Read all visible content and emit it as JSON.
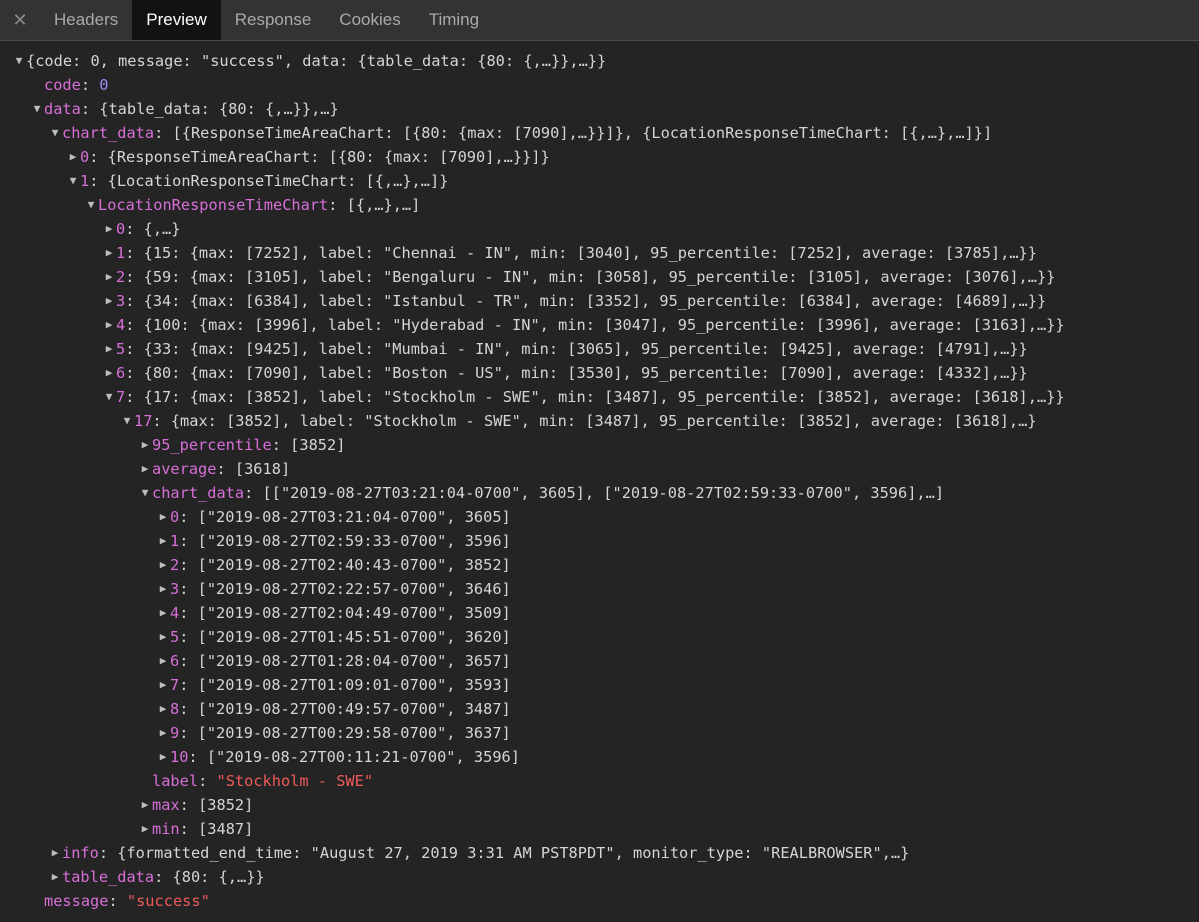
{
  "tabs": {
    "close_glyph": "✕",
    "items": [
      {
        "label": "Headers",
        "active": false
      },
      {
        "label": "Preview",
        "active": true
      },
      {
        "label": "Response",
        "active": false
      },
      {
        "label": "Cookies",
        "active": false
      },
      {
        "label": "Timing",
        "active": false
      }
    ]
  },
  "tree": [
    {
      "indent": 0,
      "toggle": "expanded",
      "text": "{code: 0, message: \"success\", data: {table_data: {80: {,…}},…}}"
    },
    {
      "indent": 1,
      "toggle": "none",
      "key": "code",
      "sep": ": ",
      "value": "0",
      "vtype": "num"
    },
    {
      "indent": 1,
      "toggle": "expanded",
      "key": "data",
      "sep": ": ",
      "value": "{table_data: {80: {,…}},…}",
      "vtype": "plain"
    },
    {
      "indent": 2,
      "toggle": "expanded",
      "key": "chart_data",
      "sep": ": ",
      "value": "[{ResponseTimeAreaChart: [{80: {max: [7090],…}}]}, {LocationResponseTimeChart: [{,…},…]}]",
      "vtype": "plain"
    },
    {
      "indent": 3,
      "toggle": "collapsed",
      "key": "0",
      "sep": ": ",
      "value": "{ResponseTimeAreaChart: [{80: {max: [7090],…}}]}",
      "vtype": "plain"
    },
    {
      "indent": 3,
      "toggle": "expanded",
      "key": "1",
      "sep": ": ",
      "value": "{LocationResponseTimeChart: [{,…},…]}",
      "vtype": "plain"
    },
    {
      "indent": 4,
      "toggle": "expanded",
      "key": "LocationResponseTimeChart",
      "sep": ": ",
      "value": "[{,…},…]",
      "vtype": "plain"
    },
    {
      "indent": 5,
      "toggle": "collapsed",
      "key": "0",
      "sep": ": ",
      "value": "{,…}",
      "vtype": "plain"
    },
    {
      "indent": 5,
      "toggle": "collapsed",
      "key": "1",
      "sep": ": ",
      "value": "{15: {max: [7252], label: \"Chennai - IN\", min: [3040], 95_percentile: [7252], average: [3785],…}}",
      "vtype": "plain"
    },
    {
      "indent": 5,
      "toggle": "collapsed",
      "key": "2",
      "sep": ": ",
      "value": "{59: {max: [3105], label: \"Bengaluru - IN\", min: [3058], 95_percentile: [3105], average: [3076],…}}",
      "vtype": "plain"
    },
    {
      "indent": 5,
      "toggle": "collapsed",
      "key": "3",
      "sep": ": ",
      "value": "{34: {max: [6384], label: \"Istanbul - TR\", min: [3352], 95_percentile: [6384], average: [4689],…}}",
      "vtype": "plain"
    },
    {
      "indent": 5,
      "toggle": "collapsed",
      "key": "4",
      "sep": ": ",
      "value": "{100: {max: [3996], label: \"Hyderabad - IN\", min: [3047], 95_percentile: [3996], average: [3163],…}}",
      "vtype": "plain"
    },
    {
      "indent": 5,
      "toggle": "collapsed",
      "key": "5",
      "sep": ": ",
      "value": "{33: {max: [9425], label: \"Mumbai - IN\", min: [3065], 95_percentile: [9425], average: [4791],…}}",
      "vtype": "plain"
    },
    {
      "indent": 5,
      "toggle": "collapsed",
      "key": "6",
      "sep": ": ",
      "value": "{80: {max: [7090], label: \"Boston - US\", min: [3530], 95_percentile: [7090], average: [4332],…}}",
      "vtype": "plain"
    },
    {
      "indent": 5,
      "toggle": "expanded",
      "key": "7",
      "sep": ": ",
      "value": "{17: {max: [3852], label: \"Stockholm - SWE\", min: [3487], 95_percentile: [3852], average: [3618],…}}",
      "vtype": "plain"
    },
    {
      "indent": 6,
      "toggle": "expanded",
      "key": "17",
      "sep": ": ",
      "value": "{max: [3852], label: \"Stockholm - SWE\", min: [3487], 95_percentile: [3852], average: [3618],…}",
      "vtype": "plain"
    },
    {
      "indent": 7,
      "toggle": "collapsed",
      "key": "95_percentile",
      "sep": ": ",
      "value": "[3852]",
      "vtype": "plain"
    },
    {
      "indent": 7,
      "toggle": "collapsed",
      "key": "average",
      "sep": ": ",
      "value": "[3618]",
      "vtype": "plain"
    },
    {
      "indent": 7,
      "toggle": "expanded",
      "key": "chart_data",
      "sep": ": ",
      "value": "[[\"2019-08-27T03:21:04-0700\", 3605], [\"2019-08-27T02:59:33-0700\", 3596],…]",
      "vtype": "plain"
    },
    {
      "indent": 8,
      "toggle": "collapsed",
      "key": "0",
      "sep": ": ",
      "value": "[\"2019-08-27T03:21:04-0700\", 3605]",
      "vtype": "plain"
    },
    {
      "indent": 8,
      "toggle": "collapsed",
      "key": "1",
      "sep": ": ",
      "value": "[\"2019-08-27T02:59:33-0700\", 3596]",
      "vtype": "plain"
    },
    {
      "indent": 8,
      "toggle": "collapsed",
      "key": "2",
      "sep": ": ",
      "value": "[\"2019-08-27T02:40:43-0700\", 3852]",
      "vtype": "plain"
    },
    {
      "indent": 8,
      "toggle": "collapsed",
      "key": "3",
      "sep": ": ",
      "value": "[\"2019-08-27T02:22:57-0700\", 3646]",
      "vtype": "plain"
    },
    {
      "indent": 8,
      "toggle": "collapsed",
      "key": "4",
      "sep": ": ",
      "value": "[\"2019-08-27T02:04:49-0700\", 3509]",
      "vtype": "plain"
    },
    {
      "indent": 8,
      "toggle": "collapsed",
      "key": "5",
      "sep": ": ",
      "value": "[\"2019-08-27T01:45:51-0700\", 3620]",
      "vtype": "plain"
    },
    {
      "indent": 8,
      "toggle": "collapsed",
      "key": "6",
      "sep": ": ",
      "value": "[\"2019-08-27T01:28:04-0700\", 3657]",
      "vtype": "plain"
    },
    {
      "indent": 8,
      "toggle": "collapsed",
      "key": "7",
      "sep": ": ",
      "value": "[\"2019-08-27T01:09:01-0700\", 3593]",
      "vtype": "plain"
    },
    {
      "indent": 8,
      "toggle": "collapsed",
      "key": "8",
      "sep": ": ",
      "value": "[\"2019-08-27T00:49:57-0700\", 3487]",
      "vtype": "plain"
    },
    {
      "indent": 8,
      "toggle": "collapsed",
      "key": "9",
      "sep": ": ",
      "value": "[\"2019-08-27T00:29:58-0700\", 3637]",
      "vtype": "plain"
    },
    {
      "indent": 8,
      "toggle": "collapsed",
      "key": "10",
      "sep": ": ",
      "value": "[\"2019-08-27T00:11:21-0700\", 3596]",
      "vtype": "plain"
    },
    {
      "indent": 7,
      "toggle": "none",
      "key": "label",
      "sep": ": ",
      "value": "\"Stockholm - SWE\"",
      "vtype": "str"
    },
    {
      "indent": 7,
      "toggle": "collapsed",
      "key": "max",
      "sep": ": ",
      "value": "[3852]",
      "vtype": "plain"
    },
    {
      "indent": 7,
      "toggle": "collapsed",
      "key": "min",
      "sep": ": ",
      "value": "[3487]",
      "vtype": "plain"
    },
    {
      "indent": 2,
      "toggle": "collapsed",
      "key": "info",
      "sep": ": ",
      "value": "{formatted_end_time: \"August 27, 2019 3:31 AM PST8PDT\", monitor_type: \"REALBROWSER\",…}",
      "vtype": "plain"
    },
    {
      "indent": 2,
      "toggle": "collapsed",
      "key": "table_data",
      "sep": ": ",
      "value": "{80: {,…}}",
      "vtype": "plain"
    },
    {
      "indent": 1,
      "toggle": "none",
      "key": "message",
      "sep": ": ",
      "value": "\"success\"",
      "vtype": "str"
    }
  ]
}
